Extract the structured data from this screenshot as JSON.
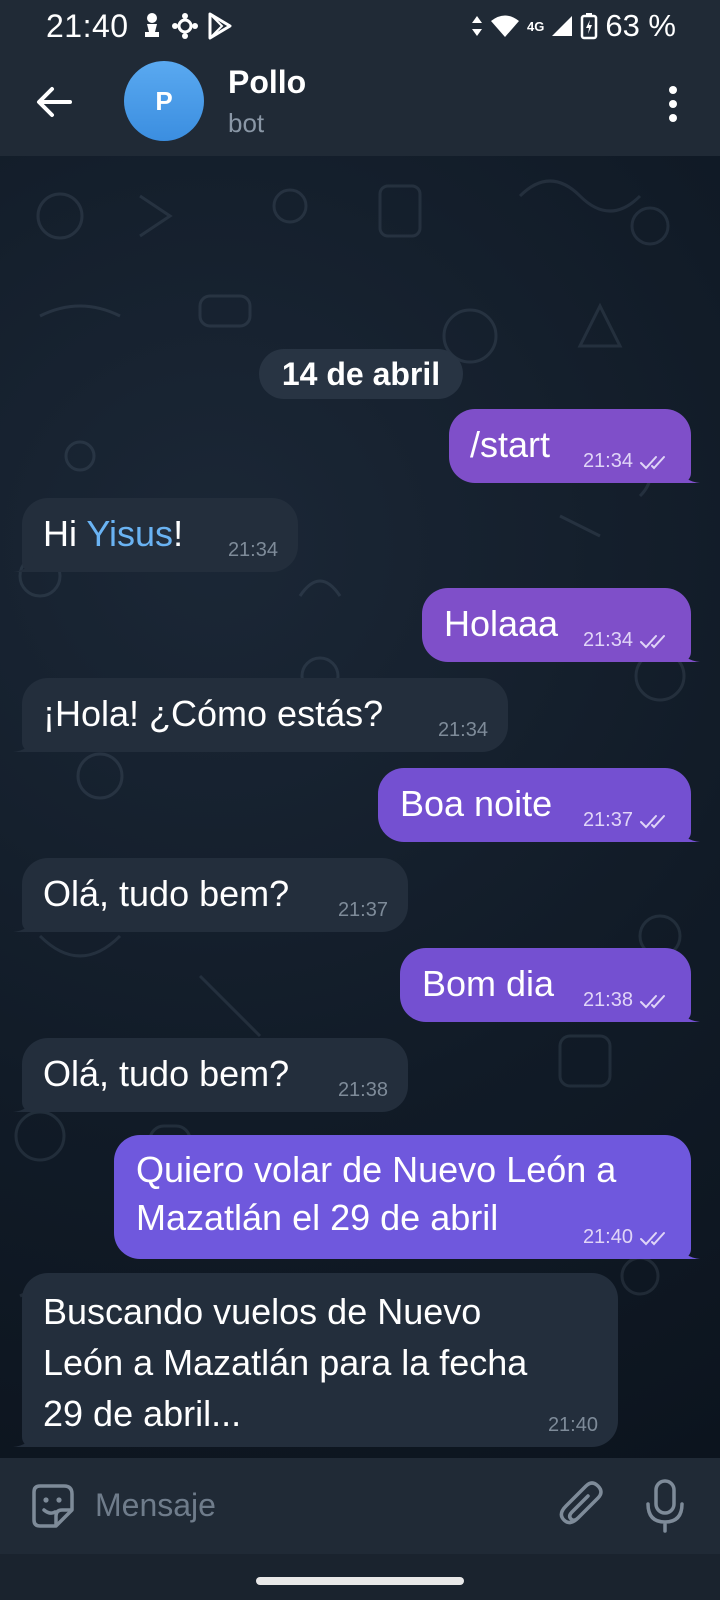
{
  "status_bar": {
    "time": "21:40",
    "network": "4G",
    "battery": "63 %"
  },
  "header": {
    "avatar_letter": "P",
    "title": "Pollo",
    "subtitle": "bot"
  },
  "chat": {
    "date_label": "14 de abril",
    "messages": [
      {
        "dir": "out",
        "text": "/start",
        "time": "21:34"
      },
      {
        "dir": "in",
        "text_prefix": "Hi ",
        "mention": "Yisus",
        "text_suffix": "!",
        "time": "21:34"
      },
      {
        "dir": "out",
        "text": "Holaaa",
        "time": "21:34"
      },
      {
        "dir": "in",
        "text": "¡Hola! ¿Cómo estás?",
        "time": "21:34"
      },
      {
        "dir": "out",
        "text": "Boa noite",
        "time": "21:37"
      },
      {
        "dir": "in",
        "text": "Olá, tudo bem?",
        "time": "21:37"
      },
      {
        "dir": "out",
        "text": "Bom dia",
        "time": "21:38"
      },
      {
        "dir": "in",
        "text": "Olá, tudo bem?",
        "time": "21:38"
      },
      {
        "dir": "out",
        "lines": [
          "Quiero volar de Nuevo León a",
          "Mazatlán el 29 de abril"
        ],
        "time": "21:40"
      },
      {
        "dir": "in",
        "lines": [
          "Buscando vuelos de Nuevo",
          "León a Mazatlán para la fecha",
          "29 de abril..."
        ],
        "time": "21:40"
      }
    ]
  },
  "composer": {
    "placeholder": "Mensaje"
  },
  "colors": {
    "outgoing": "#7f4fc9",
    "incoming": "#232e3c",
    "mention": "#6ab3f3",
    "header": "#202a36"
  }
}
